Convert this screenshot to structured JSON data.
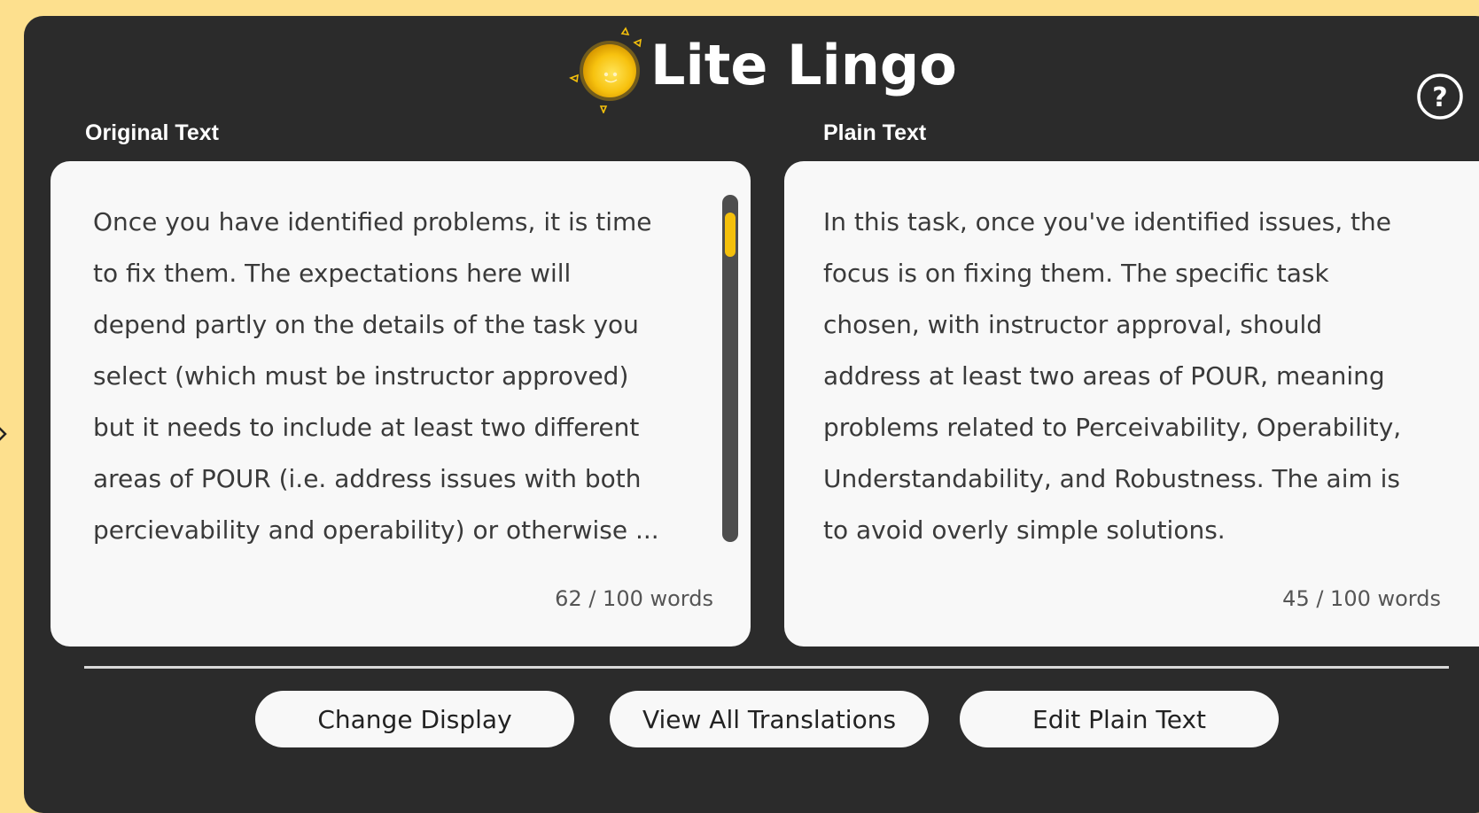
{
  "app": {
    "title": "Lite Lingo"
  },
  "original": {
    "label": "Original Text",
    "lines": [
      "Once you have identified problems, it is time",
      "to fix them. The expectations here will",
      "depend partly on the details of the task you",
      "select (which must be instructor approved)",
      "but it needs to include at least two different",
      "areas of POUR (i.e. address issues with both",
      "percievability and operability) or otherwise ..."
    ],
    "word_count": "62 / 100 words",
    "scroll_position": 0.05
  },
  "plain": {
    "label": "Plain Text",
    "lines": [
      "In this task, once you've identified issues, the",
      "focus is on fixing them. The specific task",
      "chosen, with instructor approval, should",
      "address at least two areas of POUR, meaning",
      "problems related to Perceivability, Operability,",
      "Understandability, and Robustness. The aim is",
      "to avoid overly simple solutions."
    ],
    "word_count": "45 / 100 words"
  },
  "actions": {
    "change_display": "Change Display",
    "view_all_translations": "View All Translations",
    "edit_plain_text": "Edit Plain Text"
  },
  "colors": {
    "background": "#fde08e",
    "panel": "#2b2b2b",
    "card": "#f8f8f8",
    "accent": "#f4c00c"
  },
  "icons": {
    "logo": "sun-icon",
    "help": "help-icon",
    "edge": "chevron-right-icon"
  }
}
